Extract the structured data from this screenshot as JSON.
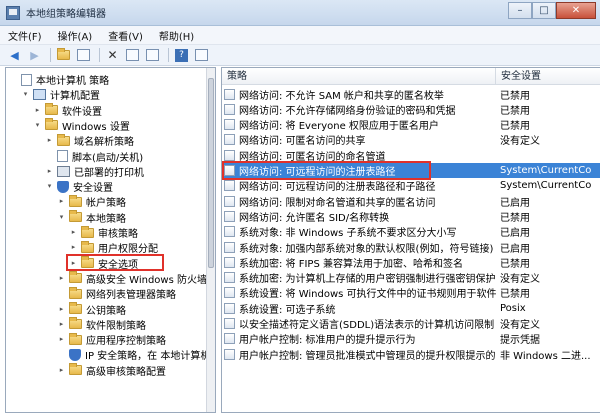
{
  "window": {
    "title": "本地组策略编辑器"
  },
  "menu": [
    {
      "label": "文件(F)"
    },
    {
      "label": "操作(A)"
    },
    {
      "label": "查看(V)"
    },
    {
      "label": "帮助(H)"
    }
  ],
  "toolbar": {
    "back_icon": "back-arrow-icon",
    "forward_icon": "forward-arrow-icon",
    "up_icon": "up-folder-icon",
    "show_tree_icon": "show-tree-icon",
    "delete_icon": "delete-icon",
    "properties_icon": "properties-icon",
    "export_icon": "export-list-icon",
    "help_icon": "help-icon"
  },
  "tree": {
    "items": [
      {
        "label": "本地计算机 策略",
        "indent": 0,
        "icon": "computer-policy-icon",
        "expander": ""
      },
      {
        "label": "计算机配置",
        "indent": 1,
        "icon": "computer-icon",
        "expander": "▾"
      },
      {
        "label": "软件设置",
        "indent": 2,
        "icon": "folder-icon",
        "expander": "▸"
      },
      {
        "label": "Windows 设置",
        "indent": 2,
        "icon": "folder-icon",
        "expander": "▾"
      },
      {
        "label": "域名解析策略",
        "indent": 3,
        "icon": "folder-icon",
        "expander": "▸"
      },
      {
        "label": "脚本(启动/关机)",
        "indent": 3,
        "icon": "document-icon",
        "expander": ""
      },
      {
        "label": "已部署的打印机",
        "indent": 3,
        "icon": "printer-icon",
        "expander": "▸"
      },
      {
        "label": "安全设置",
        "indent": 3,
        "icon": "shield-icon",
        "expander": "▾"
      },
      {
        "label": "帐户策略",
        "indent": 4,
        "icon": "folder-icon",
        "expander": "▸"
      },
      {
        "label": "本地策略",
        "indent": 4,
        "icon": "folder-icon",
        "expander": "▾"
      },
      {
        "label": "审核策略",
        "indent": 5,
        "icon": "folder-icon",
        "expander": "▸"
      },
      {
        "label": "用户权限分配",
        "indent": 5,
        "icon": "folder-icon",
        "expander": "▸"
      },
      {
        "label": "安全选项",
        "indent": 5,
        "icon": "folder-icon",
        "expander": "▸",
        "highlighted": true
      },
      {
        "label": "高级安全 Windows 防火墙",
        "indent": 4,
        "icon": "folder-icon",
        "expander": "▸"
      },
      {
        "label": "网络列表管理器策略",
        "indent": 4,
        "icon": "folder-icon",
        "expander": ""
      },
      {
        "label": "公钥策略",
        "indent": 4,
        "icon": "folder-icon",
        "expander": "▸"
      },
      {
        "label": "软件限制策略",
        "indent": 4,
        "icon": "folder-icon",
        "expander": "▸"
      },
      {
        "label": "应用程序控制策略",
        "indent": 4,
        "icon": "folder-icon",
        "expander": "▸"
      },
      {
        "label": "IP 安全策略，在 本地计算机",
        "indent": 4,
        "icon": "shield-icon",
        "expander": ""
      },
      {
        "label": "高级审核策略配置",
        "indent": 4,
        "icon": "folder-icon",
        "expander": "▸"
      }
    ]
  },
  "list": {
    "columns": {
      "policy": "策略",
      "setting": "安全设置"
    },
    "rows": [
      {
        "policy": "网络访问: 不允许 SAM 帐户和共享的匿名枚举",
        "setting": "已禁用"
      },
      {
        "policy": "网络访问: 不允许存储网络身份验证的密码和凭据",
        "setting": "已禁用"
      },
      {
        "policy": "网络访问: 将 Everyone 权限应用于匿名用户",
        "setting": "已禁用"
      },
      {
        "policy": "网络访问: 可匿名访问的共享",
        "setting": "没有定义"
      },
      {
        "policy": "网络访问: 可匿名访问的命名管道",
        "setting": ""
      },
      {
        "policy": "网络访问: 可远程访问的注册表路径",
        "setting": "System\\CurrentCo",
        "selected": true,
        "highlighted": true
      },
      {
        "policy": "网络访问: 可远程访问的注册表路径和子路径",
        "setting": "System\\CurrentCo"
      },
      {
        "policy": "网络访问: 限制对命名管道和共享的匿名访问",
        "setting": "已启用"
      },
      {
        "policy": "网络访问: 允许匿名 SID/名称转换",
        "setting": "已禁用"
      },
      {
        "policy": "系统对象: 非 Windows 子系统不要求区分大小写",
        "setting": "已启用"
      },
      {
        "policy": "系统对象: 加强内部系统对象的默认权限(例如，符号链接)",
        "setting": "已启用"
      },
      {
        "policy": "系统加密: 将 FIPS 兼容算法用于加密、哈希和签名",
        "setting": "已禁用"
      },
      {
        "policy": "系统加密: 为计算机上存储的用户密钥强制进行强密钥保护",
        "setting": "没有定义"
      },
      {
        "policy": "系统设置: 将 Windows 可执行文件中的证书规则用于软件...",
        "setting": "已禁用"
      },
      {
        "policy": "系统设置: 可选子系统",
        "setting": "Posix"
      },
      {
        "policy": "以安全描述符定义语言(SDDL)语法表示的计算机访问限制",
        "setting": "没有定义"
      },
      {
        "policy": "用户帐户控制: 标准用户的提升提示行为",
        "setting": "提示凭据"
      },
      {
        "policy": "用户帐户控制: 管理员批准模式中管理员的提升权限提示的...",
        "setting": "非 Windows 二进..."
      }
    ]
  }
}
